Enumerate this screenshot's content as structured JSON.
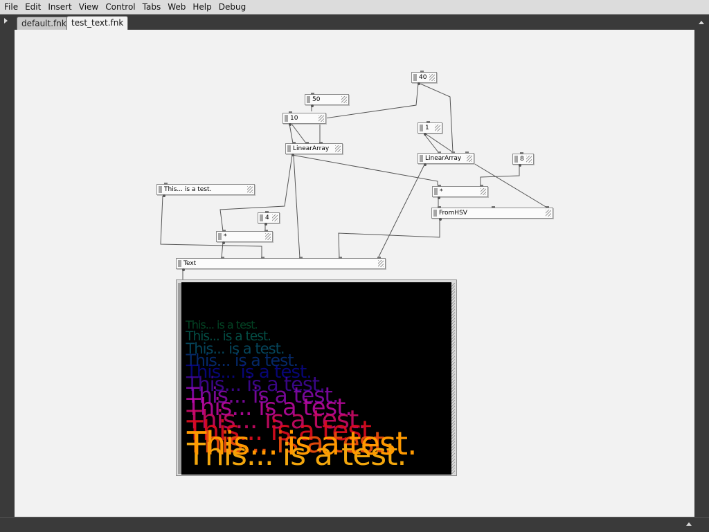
{
  "menu": [
    "File",
    "Edit",
    "Insert",
    "View",
    "Control",
    "Tabs",
    "Web",
    "Help",
    "Debug"
  ],
  "tabs": [
    {
      "label": "default.fnk",
      "active": false
    },
    {
      "label": "test_text.fnk",
      "active": true
    }
  ],
  "nodes": {
    "n40": "40",
    "n50": "50",
    "n10": "10",
    "n1": "1",
    "linear_array_1": "LinearArray",
    "linear_array_2": "LinearArray",
    "n8": "8",
    "text_const": "This... is a test.",
    "multiply_1": "*",
    "fromhsv": "FromHSV",
    "n4": "4",
    "multiply_2": "*",
    "text_node": "Text"
  },
  "render": {
    "text": "This... is a test.",
    "background": "#000000",
    "foreground_text_color": "#ff9900"
  },
  "colors": {
    "menubar": "#dcdcdc",
    "frame": "#3a3a3a",
    "canvas": "#f2f2f2",
    "wire": "#555555"
  }
}
